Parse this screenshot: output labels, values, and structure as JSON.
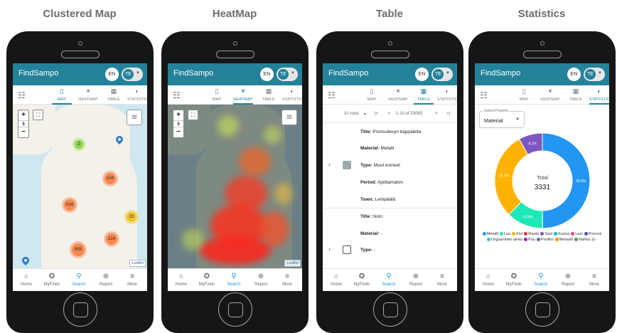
{
  "panels": [
    {
      "title": "Clustered Map"
    },
    {
      "title": "HeatMap"
    },
    {
      "title": "Table"
    },
    {
      "title": "Statistics"
    }
  ],
  "app": {
    "brand": "FindSampo",
    "lang": "EN",
    "user_initials": "TE"
  },
  "tabs": [
    {
      "label": "MAP",
      "icon": "map-icon"
    },
    {
      "label": "HEATMAP",
      "icon": "sun-icon"
    },
    {
      "label": "TABLE",
      "icon": "table-icon"
    },
    {
      "label": "STATISTICS",
      "icon": "pie-chart-icon"
    }
  ],
  "bottom_nav": [
    {
      "label": "Home",
      "icon": "home-icon"
    },
    {
      "label": "MyFinds",
      "icon": "star-badge-icon"
    },
    {
      "label": "Search",
      "icon": "search-icon"
    },
    {
      "label": "Report",
      "icon": "add-circle-icon"
    },
    {
      "label": "More",
      "icon": "menu-icon"
    }
  ],
  "map": {
    "zoom_level": "5",
    "attribution": "Leaflet",
    "clusters": [
      "2",
      "104",
      "514",
      "22",
      "214",
      "955"
    ]
  },
  "table": {
    "rows_per_page": "10 rows",
    "range": "1-10 of 23065",
    "rows": [
      {
        "title_label": "Title:",
        "title": "Pronssilevyn kappaleita",
        "material_label": "Material:",
        "material": "Metalli",
        "type_label": "Type:",
        "type": "Muut esineet",
        "period_label": "Period:",
        "period": "Ajoittamaton",
        "town_label": "Town:",
        "town": "Lempäälä"
      },
      {
        "title_label": "Title:",
        "title": "hioin",
        "material_label": "Material:",
        "material": "-",
        "type_label": "Type:",
        "type": "-"
      }
    ]
  },
  "statistics": {
    "select_label": "Select Property",
    "select_value": "Material",
    "total_label": "Total",
    "total_value": "3331",
    "slice_labels": [
      "50.0%",
      "12.5%",
      "29.5%",
      "8.1%"
    ],
    "legend": [
      {
        "name": "Metalli",
        "color": "#2196f3"
      },
      {
        "name": "Luu",
        "color": "#1de9b6"
      },
      {
        "name": "Kivi",
        "color": "#ffb300"
      },
      {
        "name": "Rauta",
        "color": "#e53935"
      },
      {
        "name": "Savi",
        "color": "#7e57c2"
      },
      {
        "name": "Kuona",
        "color": "#00bcd4"
      },
      {
        "name": "Lasi",
        "color": "#ec407a"
      },
      {
        "name": "Pronssi",
        "color": "#3f51b5"
      },
      {
        "name": "Orgaaninen aines",
        "color": "#26c6da"
      },
      {
        "name": "Puu",
        "color": "#8e24aa"
      },
      {
        "name": "Posliini",
        "color": "#5c6bc0"
      },
      {
        "name": "Metaalli",
        "color": "#fb8c00"
      },
      {
        "name": "Nahka",
        "color": "#43a047"
      },
      {
        "name": "-",
        "color": "#bdbdbd"
      }
    ]
  },
  "chart_data": {
    "type": "pie",
    "title": "",
    "categories": [
      "Metalli",
      "Luu",
      "Kivi",
      "Savi"
    ],
    "values": [
      50.0,
      12.5,
      29.5,
      8.1
    ],
    "colors": [
      "#2196f3",
      "#1de9b6",
      "#ffb300",
      "#7e57c2"
    ],
    "center_text": [
      "Total",
      "3331"
    ]
  },
  "colors": {
    "appbar": "#23829a",
    "active_nav": "#2196f3"
  }
}
